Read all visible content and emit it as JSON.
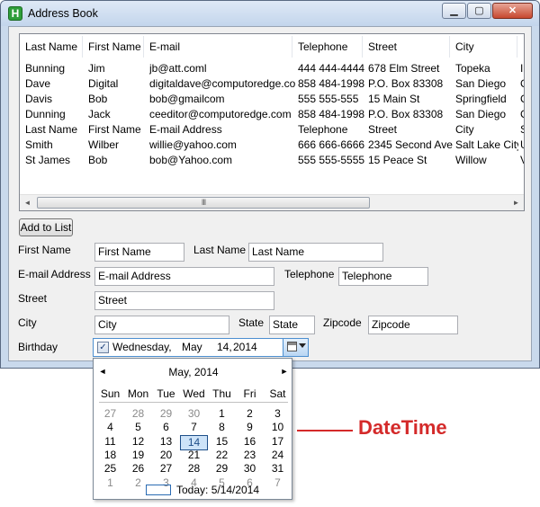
{
  "window": {
    "title": "Address Book",
    "icon_letter": "H",
    "buttons": {
      "minimize": "▁",
      "maximize": "▢",
      "close": "✕"
    }
  },
  "listview": {
    "columns": [
      "Last Name",
      "First Name",
      "E-mail",
      "Telephone",
      "Street",
      "City"
    ],
    "rows": [
      [
        "Bunning",
        "Jim",
        "jb@att.coml",
        "444 444-4444",
        "678 Elm Street",
        "Topeka",
        "I"
      ],
      [
        "Dave",
        "Digital",
        "digitaldave@computoredge.com",
        "858 484-1998",
        "P.O. Box 83308",
        "San Diego",
        "C"
      ],
      [
        "Davis",
        "Bob",
        "bob@gmailcom",
        "555 555-555",
        "15 Main St",
        "Springfield",
        "C"
      ],
      [
        "Dunning",
        "Jack",
        "ceeditor@computoredge.com",
        "858 484-1998",
        "P.O. Box 83308",
        "San Diego",
        "C"
      ],
      [
        "Last Name",
        "First Name",
        "E-mail Address",
        "Telephone",
        "Street",
        "City",
        "S"
      ],
      [
        "Smith",
        "Wilber",
        "willie@yahoo.com",
        "666 666-6666",
        "2345 Second Ave",
        "Salt Lake City",
        "U"
      ],
      [
        "St James",
        "Bob",
        "bob@Yahoo.com",
        "555 555-5555",
        "15 Peace St",
        "Willow",
        "V"
      ]
    ],
    "scroll_grip": "III"
  },
  "form": {
    "add_button": "Add to List",
    "first_name_label": "First Name",
    "first_name_value": "First Name",
    "last_name_label": "Last Name",
    "last_name_value": "Last Name",
    "email_label": "E-mail Address",
    "email_value": "E-mail Address",
    "telephone_label": "Telephone",
    "telephone_value": "Telephone",
    "street_label": "Street",
    "street_value": "Street",
    "city_label": "City",
    "city_value": "City",
    "state_label": "State",
    "state_value": "State",
    "zipcode_label": "Zipcode",
    "zipcode_value": "Zipcode",
    "birthday_label": "Birthday"
  },
  "datepicker": {
    "checked": "✓",
    "weekday": "Wednesday,",
    "month": "May",
    "day": "14,",
    "year": "2014"
  },
  "calendar": {
    "title": "May, 2014",
    "prev": "◄",
    "next": "►",
    "days_of_week": [
      "Sun",
      "Mon",
      "Tue",
      "Wed",
      "Thu",
      "Fri",
      "Sat"
    ],
    "weeks": [
      [
        "27",
        "28",
        "29",
        "30",
        "1",
        "2",
        "3"
      ],
      [
        "4",
        "5",
        "6",
        "7",
        "8",
        "9",
        "10"
      ],
      [
        "11",
        "12",
        "13",
        "14",
        "15",
        "16",
        "17"
      ],
      [
        "18",
        "19",
        "20",
        "21",
        "22",
        "23",
        "24"
      ],
      [
        "25",
        "26",
        "27",
        "28",
        "29",
        "30",
        "31"
      ],
      [
        "1",
        "2",
        "3",
        "4",
        "5",
        "6",
        "7"
      ]
    ],
    "today_text": "Today: 5/14/2014"
  },
  "annotation": {
    "label": "DateTime",
    "color": "#d42a2a"
  }
}
